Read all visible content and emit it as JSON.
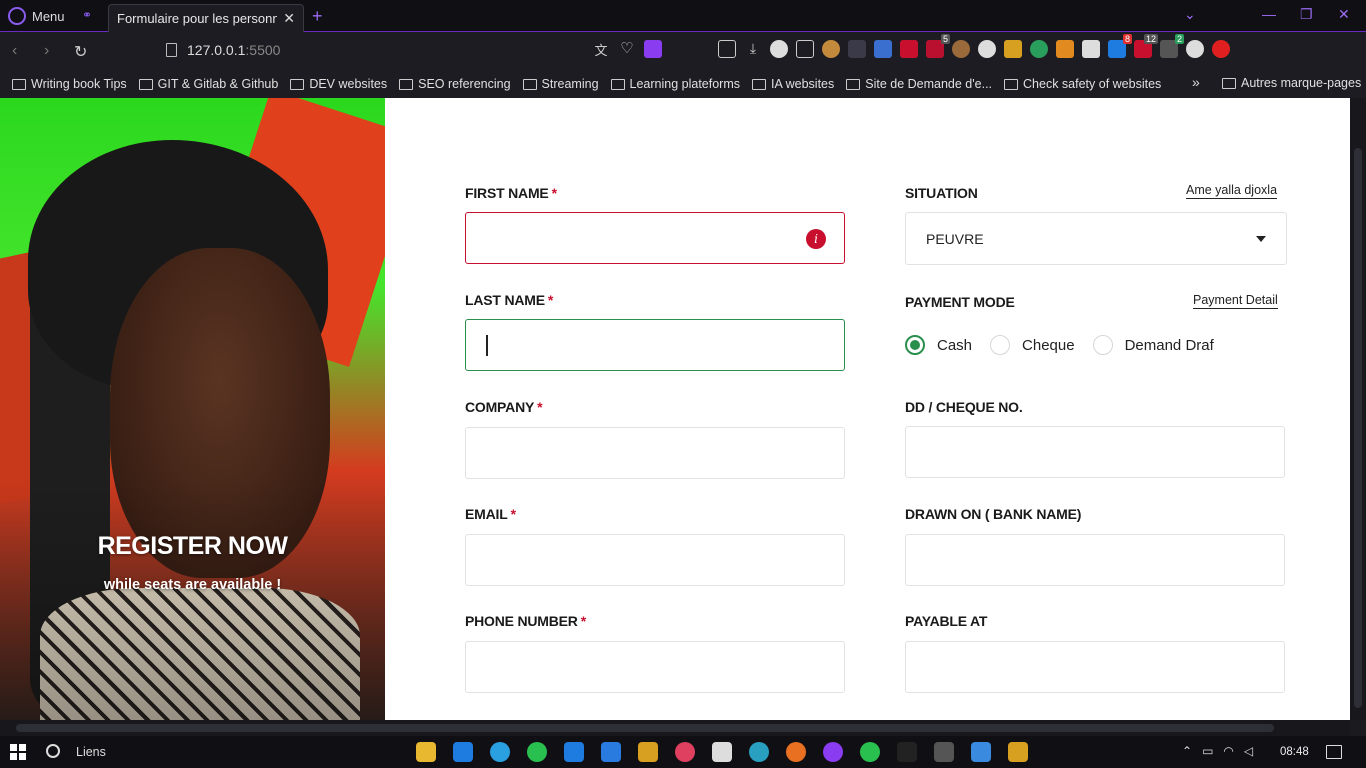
{
  "browser": {
    "menu_label": "Menu",
    "tab_title": "Formulaire pour les personnes",
    "url_host": "127.0.0.1",
    "url_port": ":5500",
    "accent_color": "#6a2bc4"
  },
  "bookmarks": [
    {
      "label": "Writing book Tips"
    },
    {
      "label": "GIT & Gitlab & Github"
    },
    {
      "label": "DEV websites"
    },
    {
      "label": "SEO referencing"
    },
    {
      "label": "Streaming"
    },
    {
      "label": "Learning plateforms"
    },
    {
      "label": "IA websites"
    },
    {
      "label": "Site de Demande d'e..."
    },
    {
      "label": "Check safety of websites"
    }
  ],
  "bookmarks_more_label": "Autres marque-pages",
  "extensions": {
    "badge_1": "5",
    "badge_2": "8",
    "badge_3": "12",
    "badge_4": "2"
  },
  "hero": {
    "title": "REGISTER NOW",
    "subtitle": "while seats are available !"
  },
  "form": {
    "first_name": {
      "label": "FIRST NAME",
      "required": "*",
      "value": "",
      "state": "error"
    },
    "last_name": {
      "label": "LAST NAME",
      "required": "*",
      "value": "",
      "state": "focused"
    },
    "company": {
      "label": "COMPANY",
      "required": "*",
      "value": ""
    },
    "email": {
      "label": "EMAIL",
      "required": "*",
      "value": ""
    },
    "phone": {
      "label": "PHONE NUMBER",
      "required": "*",
      "value": ""
    },
    "situation": {
      "label": "SITUATION",
      "link": "Ame yalla djoxla",
      "value": "PEUVRE"
    },
    "payment_mode": {
      "label": "PAYMENT MODE",
      "link": "Payment Detail",
      "options": [
        "Cash",
        "Cheque",
        "Demand Draf"
      ],
      "selected": "Cash"
    },
    "dd_cheque": {
      "label": "DD / CHEQUE NO.",
      "value": ""
    },
    "drawn_on": {
      "label": "DRAWN ON ( BANK NAME)",
      "value": ""
    },
    "payable_at": {
      "label": "PAYABLE AT",
      "value": ""
    },
    "error_color": "#c8102e",
    "focus_color": "#2a8f4d"
  },
  "taskbar": {
    "links_label": "Liens",
    "time": "08:48"
  }
}
